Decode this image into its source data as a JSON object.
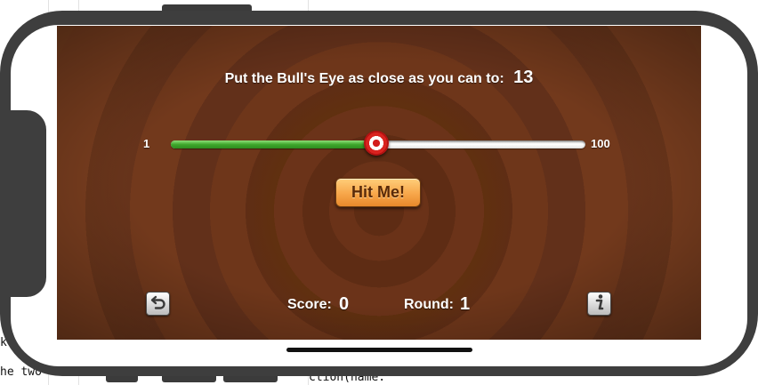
{
  "background_editor": {
    "fragment_left_1": "k",
    "fragment_left_2": "he two",
    "fragment_bottom": "ction(name:"
  },
  "game": {
    "target_prompt": "Put the Bull's Eye as close as you can to:",
    "target_value": "13",
    "slider": {
      "min_label": "1",
      "max_label": "100",
      "min": 1,
      "max": 100,
      "value": 50
    },
    "hit_button_label": "Hit Me!",
    "score_label": "Score:",
    "score_value": "0",
    "round_label": "Round:",
    "round_value": "1",
    "start_over_icon": "undo-arrow-icon",
    "info_icon": "info-i-icon"
  },
  "colors": {
    "phone_frame": "#3e3e3e",
    "wood_background": "#6a3218",
    "slider_fill": "#3ea72c",
    "slider_track": "#ffffff",
    "thumb_red": "#d31c1c",
    "button_orange": "#f7a64a",
    "button_text": "#5a2a08",
    "label_text": "#ffffff"
  }
}
